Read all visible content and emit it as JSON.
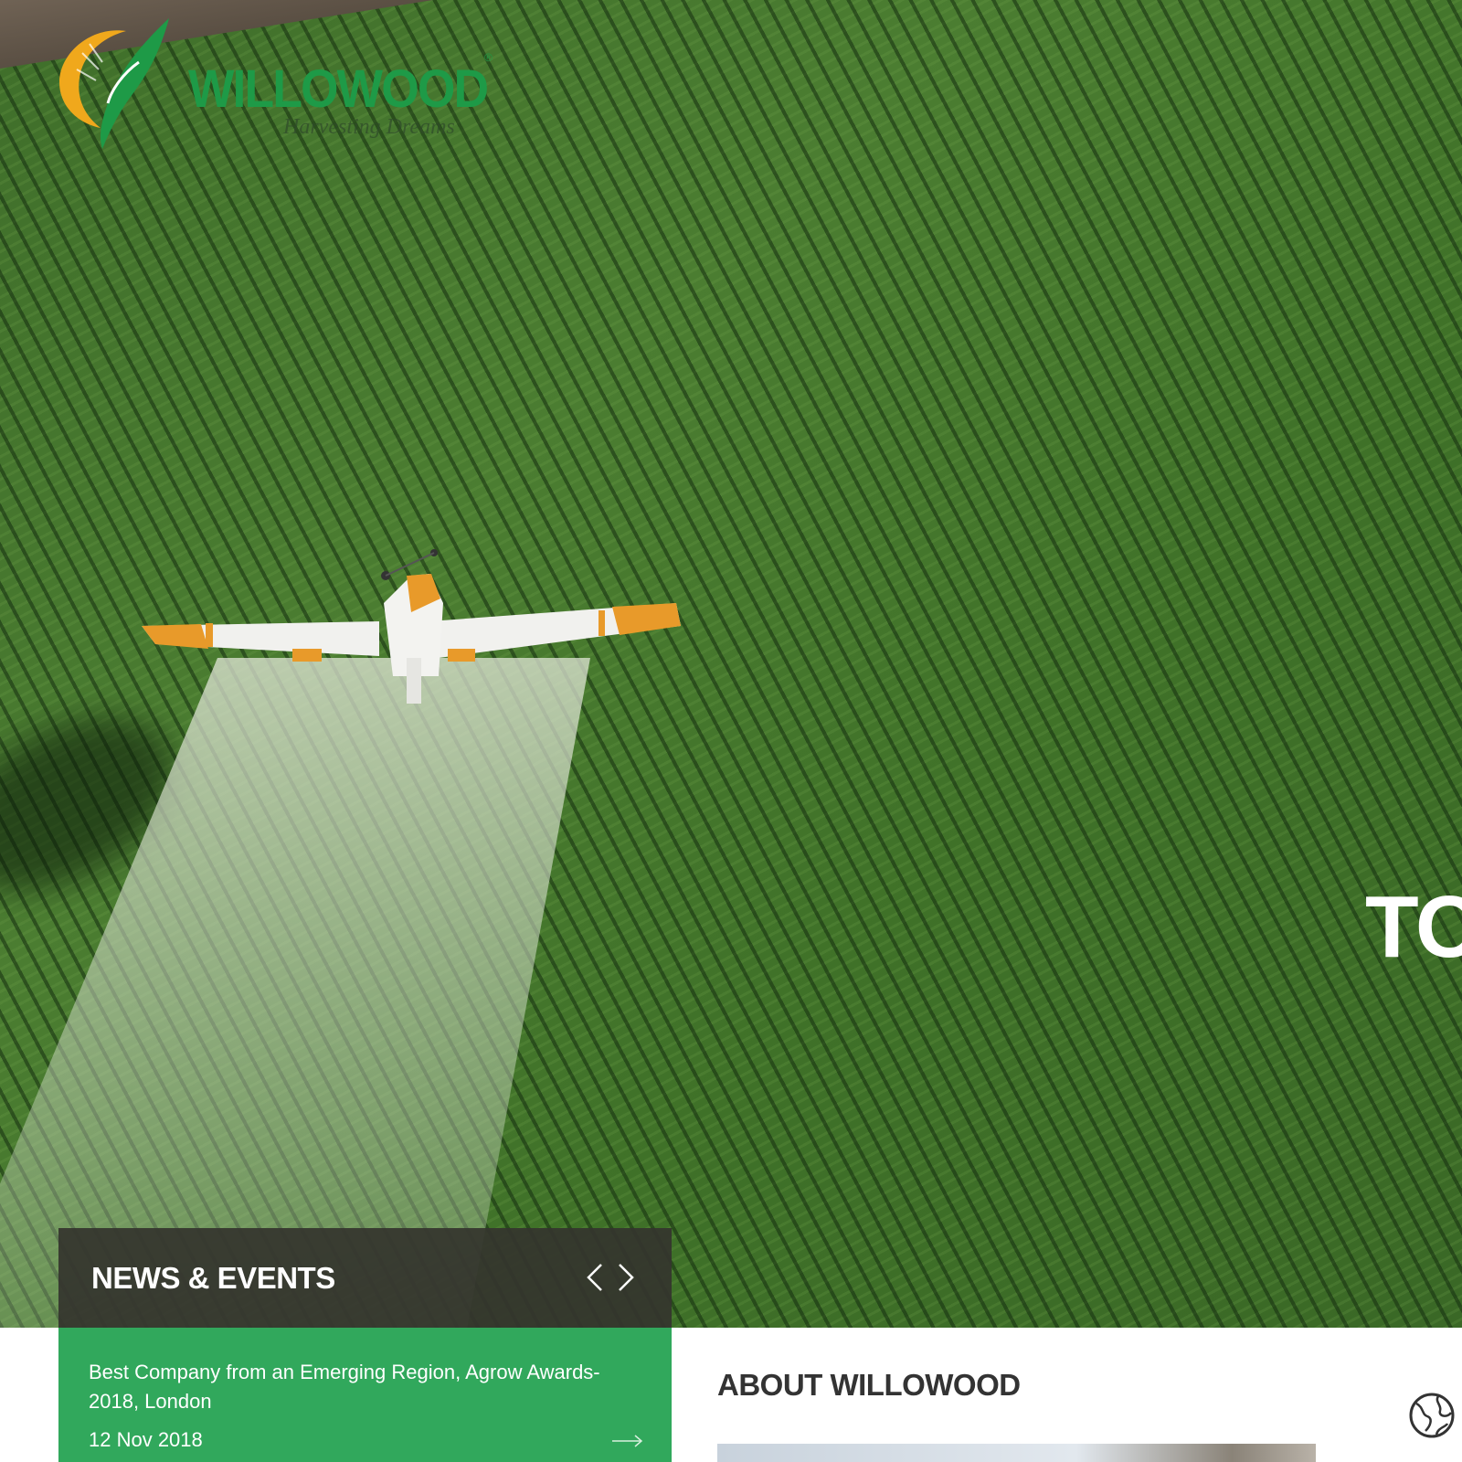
{
  "brand": {
    "name": "WILLOWOOD",
    "tagline": "Harvesting Dreams",
    "registered_mark": "®",
    "logo_icon": "wheat-leaf-logo",
    "primary_color": "#1e9a47",
    "accent_color": "#f0a81c"
  },
  "hero": {
    "headline_partial": "TO",
    "background": "aerial crop field with crop-dusting airplane"
  },
  "news": {
    "heading": "NEWS & EVENTS",
    "prev_icon": "chevron-left-icon",
    "next_icon": "chevron-right-icon",
    "panel_color": "#31a85c",
    "items": [
      {
        "title": "Best Company from an Emerging Region, Agrow Awards-2018, London",
        "date": "12 Nov 2018",
        "link_icon": "arrow-right-icon"
      }
    ]
  },
  "about": {
    "heading": "ABOUT WILLOWOOD",
    "side_icon": "globe-icon"
  }
}
